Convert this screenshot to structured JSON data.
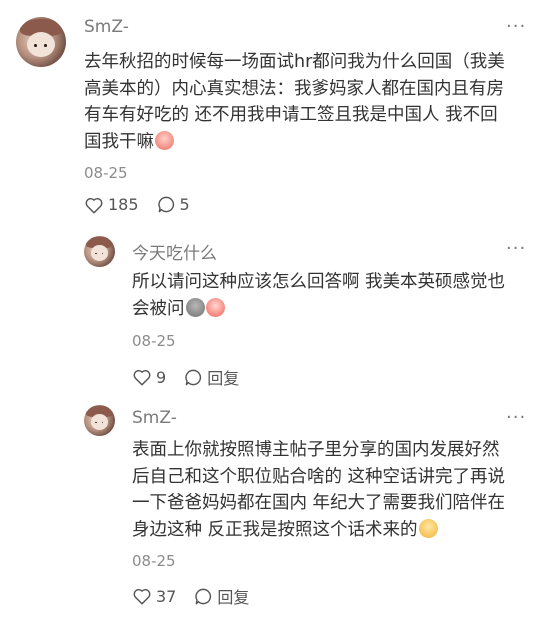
{
  "comments": [
    {
      "username": "SmZ-",
      "more_glyph": "···",
      "text_lines": [
        "去年秋招的时候每一场面试hr都问我为什么回国（我美",
        "高美本的）内心真实想法：我爹妈家人都在国内且有房",
        "有车有好吃的 还不用我申请工签且我是中国人 我不回",
        "国我干嘛"
      ],
      "emojis": [
        "blush-face"
      ],
      "date": "08-25",
      "likes": "185",
      "replies": "5"
    },
    {
      "username": "今天吃什么",
      "more_glyph": "···",
      "text_lines": [
        "所以请问这种应该怎么回答啊 我美本英硕感觉也",
        "会被问"
      ],
      "emojis": [
        "gray-face",
        "crying-face"
      ],
      "date": "08-25",
      "likes": "9",
      "reply_label": "回复"
    },
    {
      "username": "SmZ-",
      "more_glyph": "···",
      "text_lines": [
        "表面上你就按照博主帖子里分享的国内发展好然",
        "后自己和这个职位贴合啥的 这种空话讲完了再说",
        "一下爸爸妈妈都在国内 年纪大了需要我们陪伴在",
        "身边这种 反正我是按照这个话术来的"
      ],
      "emojis": [
        "smile-face"
      ],
      "date": "08-25",
      "likes": "37",
      "reply_label": "回复"
    }
  ]
}
